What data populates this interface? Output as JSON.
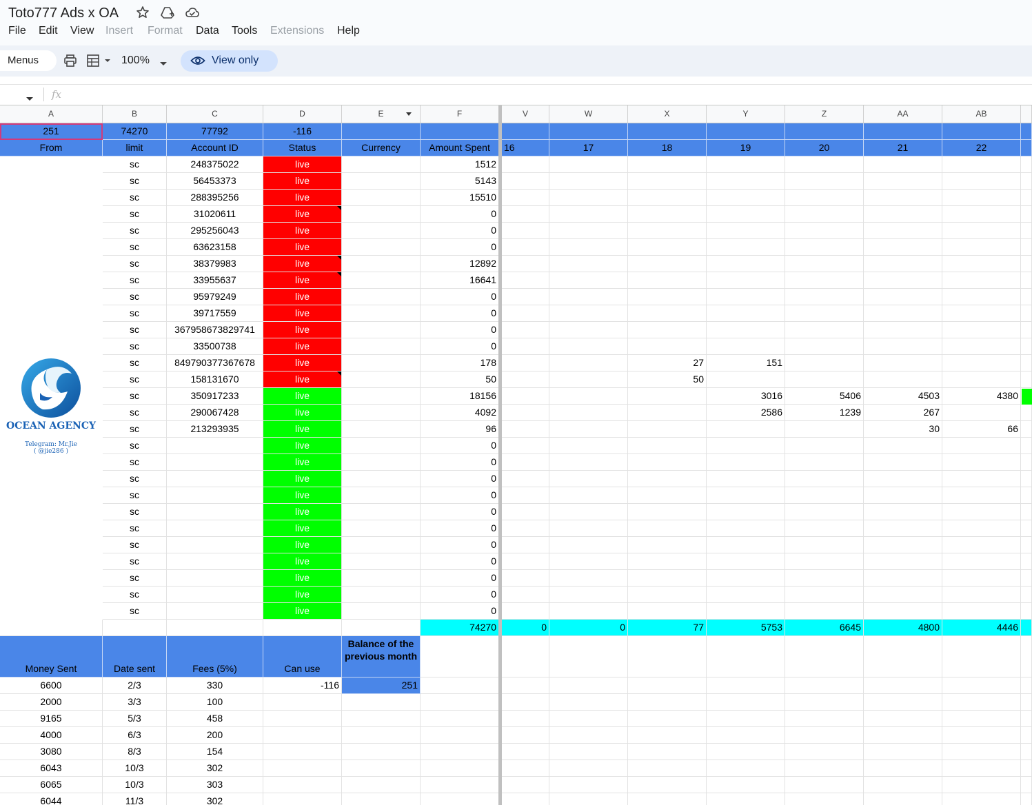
{
  "doc": {
    "title": "Toto777 Ads x OA"
  },
  "menu": [
    "File",
    "Edit",
    "View",
    "Insert",
    "Format",
    "Data",
    "Tools",
    "Extensions",
    "Help"
  ],
  "menu_disabled": [
    "Insert",
    "Format",
    "Extensions"
  ],
  "toolbar": {
    "menus": "Menus",
    "zoom": "100%",
    "view_only": "View only"
  },
  "formula": {
    "fx": "fx"
  },
  "columns": [
    "A",
    "B",
    "C",
    "D",
    "E",
    "F",
    "V",
    "W",
    "X",
    "Y",
    "Z",
    "AA",
    "AB"
  ],
  "row1": {
    "A": "251",
    "B": "74270",
    "C": "77792",
    "D": "-116"
  },
  "headers": {
    "A": "From",
    "B": "limit",
    "C": "Account ID",
    "D": "Status",
    "E": "Currency",
    "F": "Amount Spent",
    "V": "16",
    "W": "17",
    "X": "18",
    "Y": "19",
    "Z": "20",
    "AA": "21",
    "AB": "22"
  },
  "accounts": [
    {
      "limit": "sc",
      "id": "248375022",
      "status": "live",
      "color": "red",
      "spent": "1512"
    },
    {
      "limit": "sc",
      "id": "56453373",
      "status": "live",
      "color": "red",
      "spent": "5143"
    },
    {
      "limit": "sc",
      "id": "288395256",
      "status": "live",
      "color": "red",
      "spent": "15510"
    },
    {
      "limit": "sc",
      "id": "31020611",
      "status": "live",
      "color": "red",
      "spent": "0",
      "note": true
    },
    {
      "limit": "sc",
      "id": "295256043",
      "status": "live",
      "color": "red",
      "spent": "0"
    },
    {
      "limit": "sc",
      "id": "63623158",
      "status": "live",
      "color": "red",
      "spent": "0"
    },
    {
      "limit": "sc",
      "id": "38379983",
      "status": "live",
      "color": "red",
      "spent": "12892",
      "note": true
    },
    {
      "limit": "sc",
      "id": "33955637",
      "status": "live",
      "color": "red",
      "spent": "16641",
      "note": true
    },
    {
      "limit": "sc",
      "id": "95979249",
      "status": "live",
      "color": "red",
      "spent": "0"
    },
    {
      "limit": "sc",
      "id": "39717559",
      "status": "live",
      "color": "red",
      "spent": "0"
    },
    {
      "limit": "sc",
      "id": "367958673829741",
      "status": "live",
      "color": "red",
      "spent": "0"
    },
    {
      "limit": "sc",
      "id": "33500738",
      "status": "live",
      "color": "red",
      "spent": "0"
    },
    {
      "limit": "sc",
      "id": "849790377367678",
      "status": "live",
      "color": "red",
      "spent": "178",
      "X": "27",
      "Y": "151"
    },
    {
      "limit": "sc",
      "id": "158131670",
      "status": "live",
      "color": "red",
      "spent": "50",
      "X": "50",
      "note": true
    },
    {
      "limit": "sc",
      "id": "350917233",
      "status": "live",
      "color": "green",
      "spent": "18156",
      "Y": "3016",
      "Z": "5406",
      "AA": "4503",
      "AB": "4380"
    },
    {
      "limit": "sc",
      "id": "290067428",
      "status": "live",
      "color": "green",
      "spent": "4092",
      "Y": "2586",
      "Z": "1239",
      "AA": "267"
    },
    {
      "limit": "sc",
      "id": "213293935",
      "status": "live",
      "color": "green",
      "spent": "96",
      "AA": "30",
      "AB": "66"
    },
    {
      "limit": "sc",
      "id": "",
      "status": "live",
      "color": "green",
      "spent": "0"
    },
    {
      "limit": "sc",
      "id": "",
      "status": "live",
      "color": "green",
      "spent": "0"
    },
    {
      "limit": "sc",
      "id": "",
      "status": "live",
      "color": "green",
      "spent": "0"
    },
    {
      "limit": "sc",
      "id": "",
      "status": "live",
      "color": "green",
      "spent": "0"
    },
    {
      "limit": "sc",
      "id": "",
      "status": "live",
      "color": "green",
      "spent": "0"
    },
    {
      "limit": "sc",
      "id": "",
      "status": "live",
      "color": "green",
      "spent": "0"
    },
    {
      "limit": "sc",
      "id": "",
      "status": "live",
      "color": "green",
      "spent": "0"
    },
    {
      "limit": "sc",
      "id": "",
      "status": "live",
      "color": "green",
      "spent": "0"
    },
    {
      "limit": "sc",
      "id": "",
      "status": "live",
      "color": "green",
      "spent": "0"
    },
    {
      "limit": "sc",
      "id": "",
      "status": "live",
      "color": "green",
      "spent": "0"
    },
    {
      "limit": "sc",
      "id": "",
      "status": "live",
      "color": "green",
      "spent": "0"
    }
  ],
  "totals": {
    "F": "74270",
    "V": "0",
    "W": "0",
    "X": "77",
    "Y": "5753",
    "Z": "6645",
    "AA": "4800",
    "AB": "4446"
  },
  "payments_header": {
    "A": "Money Sent",
    "B": "Date sent",
    "C": "Fees (5%)",
    "D": "Can use",
    "E": "Balance of the previous month"
  },
  "payments_first": {
    "D": "-116",
    "E": "251"
  },
  "payments": [
    {
      "money": "6600",
      "date": "2/3",
      "fee": "330"
    },
    {
      "money": "2000",
      "date": "3/3",
      "fee": "100"
    },
    {
      "money": "9165",
      "date": "5/3",
      "fee": "458"
    },
    {
      "money": "4000",
      "date": "6/3",
      "fee": "200"
    },
    {
      "money": "3080",
      "date": "8/3",
      "fee": "154"
    },
    {
      "money": "6043",
      "date": "10/3",
      "fee": "302"
    },
    {
      "money": "6065",
      "date": "10/3",
      "fee": "303"
    },
    {
      "money": "6044",
      "date": "11/3",
      "fee": "302"
    }
  ],
  "logo": {
    "name": "OCEAN AGENCY",
    "line1": "Telegram: Mr.Jie",
    "line2": "( @jie286 )"
  },
  "colors": {
    "header_blue": "#4a86e8",
    "red": "#ff0000",
    "green": "#00ff00",
    "cyan": "#00ffff",
    "toolbar": "#eef2f8",
    "view_only_bg": "#d3e3fd"
  },
  "icons": [
    "star-icon",
    "move-to-drive-icon",
    "cloud-status-icon",
    "print-icon",
    "format-table-icon",
    "eye-icon",
    "name-box-dropdown-icon",
    "filter-dropdown-icon"
  ]
}
